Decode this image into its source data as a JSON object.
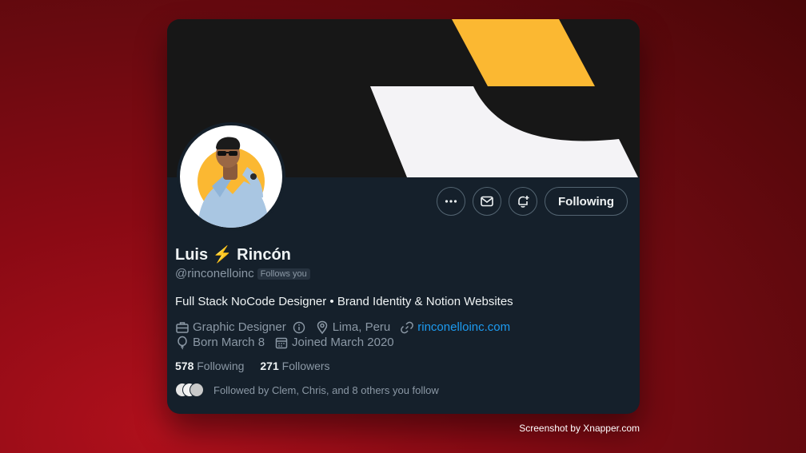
{
  "profile": {
    "name": "Luis ⚡ Rincón",
    "handle": "@rinconelloinc",
    "follows_you": "Follows you",
    "bio": "Full Stack NoCode Designer • Brand Identity & Notion Websites",
    "category": "Graphic Designer",
    "location": "Lima, Peru",
    "website": "rinconelloinc.com",
    "birthday": "Born March 8",
    "joined": "Joined March 2020"
  },
  "stats": {
    "following_count": "578",
    "following_label": "Following",
    "followers_count": "271",
    "followers_label": "Followers"
  },
  "followed_by": "Followed by Clem, Chris, and 8 others you follow",
  "actions": {
    "more_icon": "more-icon",
    "message_icon": "mail-icon",
    "notify_icon": "bell-plus-icon",
    "follow_label": "Following"
  },
  "credit": "Screenshot by Xnapper.com",
  "colors": {
    "card_bg": "#15202b",
    "banner_bg": "#171717",
    "accent_yellow": "#fbb832",
    "link": "#1d9bf0",
    "muted": "#8b98a5"
  }
}
